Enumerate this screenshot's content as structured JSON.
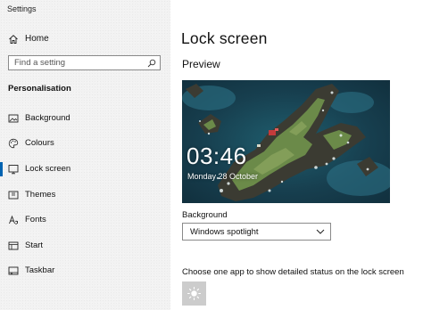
{
  "window": {
    "title": "Settings"
  },
  "sidebar": {
    "home": {
      "label": "Home",
      "icon": "home-icon"
    },
    "search": {
      "placeholder": "Find a setting",
      "icon": "search-icon"
    },
    "section_heading": "Personalisation",
    "items": [
      {
        "label": "Background",
        "icon": "picture-icon",
        "selected": false
      },
      {
        "label": "Colours",
        "icon": "palette-icon",
        "selected": false
      },
      {
        "label": "Lock screen",
        "icon": "lock-screen-icon",
        "selected": true
      },
      {
        "label": "Themes",
        "icon": "brush-icon",
        "selected": false
      },
      {
        "label": "Fonts",
        "icon": "font-icon",
        "selected": false
      },
      {
        "label": "Start",
        "icon": "start-icon",
        "selected": false
      },
      {
        "label": "Taskbar",
        "icon": "taskbar-icon",
        "selected": false
      }
    ],
    "accent_color": "#0063b1"
  },
  "main": {
    "title": "Lock screen",
    "preview_label": "Preview",
    "preview": {
      "time": "03:46",
      "date": "Monday 28 October"
    },
    "background": {
      "label": "Background",
      "selected_value": "Windows spotlight"
    },
    "status": {
      "label": "Choose one app to show detailed status on the lock screen",
      "app_icon": "brightness-icon"
    }
  }
}
